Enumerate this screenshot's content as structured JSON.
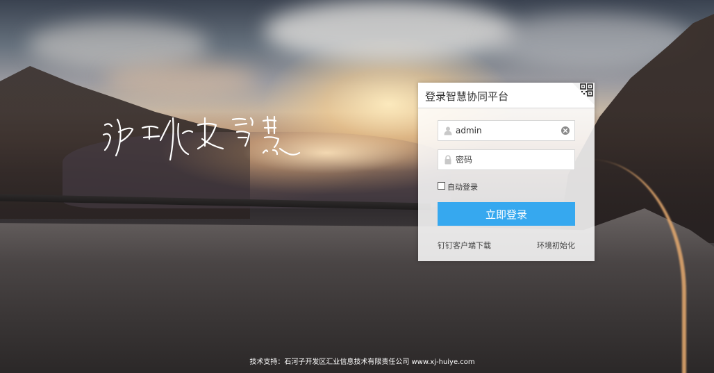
{
  "panel": {
    "title": "登录智慧协同平台",
    "username_value": "admin",
    "password_placeholder": "密码",
    "remember_label": "自动登录",
    "login_button": "立即登录",
    "download_link": "钉钉客户端下载",
    "init_link": "环境初始化"
  },
  "footer": {
    "text": "技术支持：石河子开发区汇业信息技术有限责任公司 www.xj-huiye.com"
  },
  "colors": {
    "button": "#36a8ef",
    "panel_bg": "#ffffff"
  },
  "icons": {
    "user": "user-icon",
    "lock": "lock-icon",
    "clear": "clear-icon",
    "qr": "qr-code-icon"
  }
}
